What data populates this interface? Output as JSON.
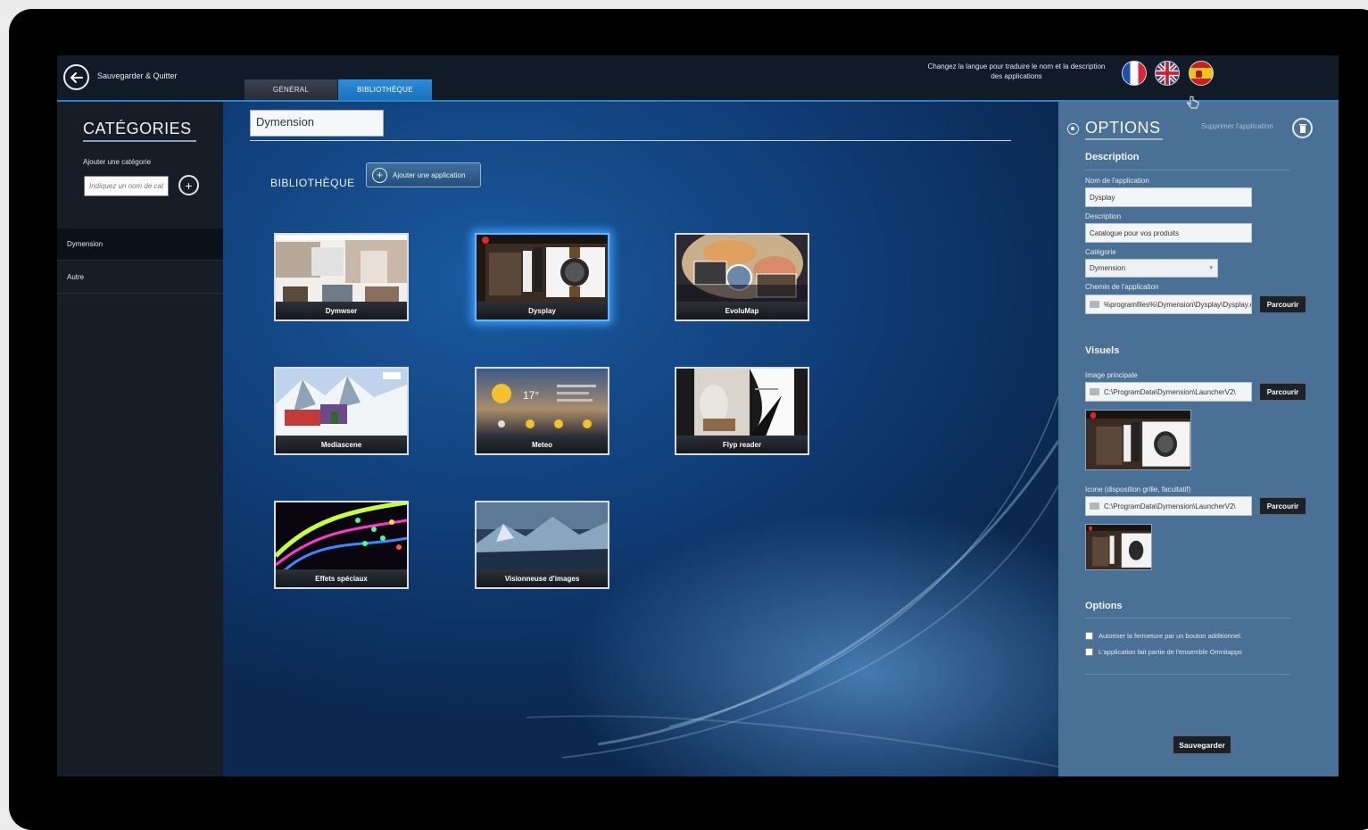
{
  "header": {
    "save_quit": "Sauvegarder & Quitter",
    "tabs": [
      {
        "label": "GÉNÉRAL",
        "active": false
      },
      {
        "label": "BIBLIOTHÈQUE",
        "active": true
      }
    ],
    "lang_hint": "Changez la langue pour traduire le nom et la description des applications",
    "flags": [
      "fr-flag-icon",
      "uk-flag-icon",
      "es-flag-icon"
    ]
  },
  "sidebar": {
    "title": "CATÉGORIES",
    "add_label": "Ajouter une catégorie",
    "add_placeholder": "Indiquez un nom de catégorie",
    "items": [
      {
        "label": "Dymension",
        "active": true
      },
      {
        "label": "Autre",
        "active": false
      }
    ]
  },
  "main": {
    "category_name": "Dymension",
    "section_title": "BIBLIOTHÈQUE",
    "add_app_label": "Ajouter une application",
    "apps": [
      {
        "label": "Dymwser",
        "selected": false
      },
      {
        "label": "Dysplay",
        "selected": true
      },
      {
        "label": "EvoluMap",
        "selected": false
      },
      {
        "label": "Mediascene",
        "selected": false
      },
      {
        "label": "Meteo",
        "selected": false
      },
      {
        "label": "Flyp reader",
        "selected": false
      },
      {
        "label": "Effets spéciaux",
        "selected": false
      },
      {
        "label": "Visionneuse d'images",
        "selected": false
      }
    ],
    "meteo_temp": "17°"
  },
  "options": {
    "title": "OPTIONS",
    "delete_label": "Supprimer l'application",
    "description": {
      "title": "Description",
      "name_label": "Nom de l'application",
      "name_value": "Dysplay",
      "desc_label": "Description",
      "desc_value": "Catalogue pour vos produits",
      "cat_label": "Catégorie",
      "cat_value": "Dymension",
      "path_label": "Chemin de l'application",
      "path_value": "%programfiles%\\Dymension\\Dysplay\\Dysplay.exe"
    },
    "visuals": {
      "title": "Visuels",
      "main_image_label": "Image principale",
      "main_image_value": "C:\\ProgramData\\Dymension\\LauncherV2\\",
      "icon_label": "Icone (disposition grille, facultatif)",
      "icon_value": "C:\\ProgramData\\Dymension\\LauncherV2\\"
    },
    "browse_label": "Parcourir",
    "options_section": {
      "title": "Options",
      "checks": [
        "Autoriser la fermeture par un bouton additionnel.",
        "L'application fait partie de l'ensemble Omnitapps"
      ]
    },
    "save_label": "Sauvegarder"
  },
  "colors": {
    "accent": "#2f82c4",
    "sidebar_bg": "#161d27",
    "options_bg": "#4b7096",
    "selection_glow": "#3ea1ff"
  }
}
